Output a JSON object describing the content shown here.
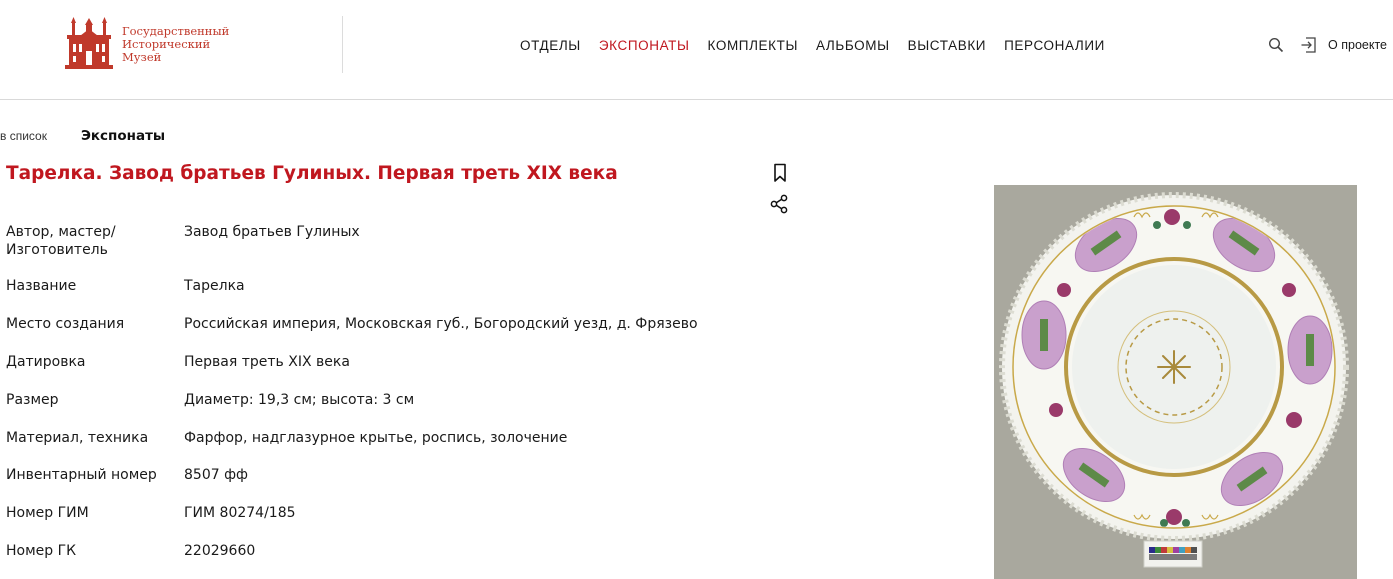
{
  "header": {
    "logo": {
      "line1": "Государственный",
      "line2": "Исторический",
      "line3": "Музей"
    },
    "nav": [
      {
        "label": "ОТДЕЛЫ",
        "active": false
      },
      {
        "label": "ЭКСПОНАТЫ",
        "active": true
      },
      {
        "label": "КОМПЛЕКТЫ",
        "active": false
      },
      {
        "label": "АЛЬБОМЫ",
        "active": false
      },
      {
        "label": "ВЫСТАВКИ",
        "active": false
      },
      {
        "label": "ПЕРСОНАЛИИ",
        "active": false
      }
    ],
    "about_label": "О проекте",
    "icons": {
      "search": "search-icon",
      "login": "login-icon"
    }
  },
  "breadcrumb": {
    "back_label": "в список",
    "current": "Экспонаты"
  },
  "item": {
    "title": "Тарелка. Завод братьев Гулиных. Первая треть XIX века",
    "attributes": [
      {
        "label": "Автор, мастер/ Изготовитель",
        "value": "Завод братьев Гулиных"
      },
      {
        "label": "Название",
        "value": "Тарелка"
      },
      {
        "label": "Место создания",
        "value": "Российская империя, Московская губ., Богородский уезд, д. Фрязево"
      },
      {
        "label": "Датировка",
        "value": "Первая треть XIX века"
      },
      {
        "label": "Размер",
        "value": "Диаметр: 19,3 см; высота: 3 см"
      },
      {
        "label": "Материал, техника",
        "value": "Фарфор, надглазурное крытье, роспись, золочение"
      },
      {
        "label": "Инвентарный номер",
        "value": "8507 фф"
      },
      {
        "label": "Номер ГИМ",
        "value": "ГИМ 80274/185"
      },
      {
        "label": "Номер ГК",
        "value": "22029660"
      }
    ]
  },
  "colors": {
    "accent": "#c0171f",
    "logo": "#c0392b",
    "photo_bg": "#a9a89e"
  }
}
